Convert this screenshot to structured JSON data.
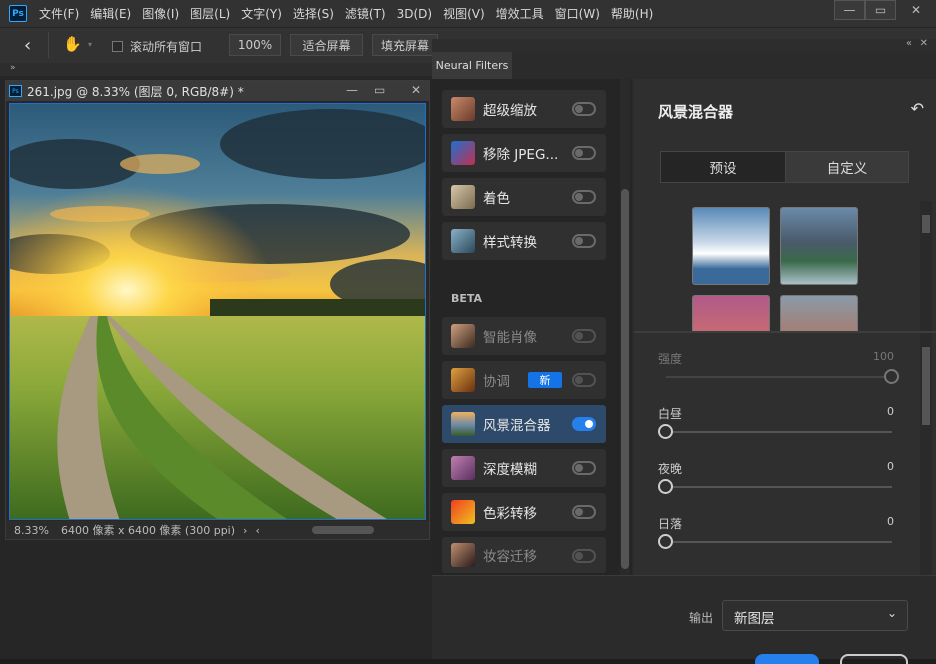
{
  "app": {
    "logo": "Ps"
  },
  "menu": [
    "文件(F)",
    "编辑(E)",
    "图像(I)",
    "图层(L)",
    "文字(Y)",
    "选择(S)",
    "滤镜(T)",
    "3D(D)",
    "视图(V)",
    "增效工具",
    "窗口(W)",
    "帮助(H)"
  ],
  "options": {
    "scroll_all_label": "滚动所有窗口",
    "zoom_button": "100%",
    "fit_screen": "适合屏幕",
    "fill_screen": "填充屏幕"
  },
  "document": {
    "title": "261.jpg @ 8.33% (图层 0, RGB/8#) *",
    "zoom": "8.33%",
    "size_info": "6400 像素 x 6400 像素 (300 ppi)"
  },
  "neural_filters": {
    "tab_label": "Neural Filters",
    "beta_label": "BETA",
    "new_badge": "新",
    "filters": [
      {
        "label": "超级缩放",
        "enabled": false,
        "dim": false
      },
      {
        "label": "移除 JPEG...",
        "enabled": false,
        "dim": false
      },
      {
        "label": "着色",
        "enabled": false,
        "dim": false
      },
      {
        "label": "样式转换",
        "enabled": false,
        "dim": false
      },
      {
        "label": "智能肖像",
        "enabled": false,
        "dim": true
      },
      {
        "label": "协调",
        "enabled": false,
        "dim": true
      },
      {
        "label": "风景混合器",
        "enabled": true,
        "dim": false
      },
      {
        "label": "深度模糊",
        "enabled": false,
        "dim": false
      },
      {
        "label": "色彩转移",
        "enabled": false,
        "dim": false
      },
      {
        "label": "妆容迁移",
        "enabled": false,
        "dim": true
      }
    ],
    "panel_title": "风景混合器",
    "seg_preset": "预设",
    "seg_custom": "自定义",
    "sliders": [
      {
        "label": "强度",
        "value": "100",
        "fraction": 1.0,
        "dim": true
      },
      {
        "label": "白昼",
        "value": "0",
        "fraction": 0.0,
        "dim": false
      },
      {
        "label": "夜晚",
        "value": "0",
        "fraction": 0.0,
        "dim": false
      },
      {
        "label": "日落",
        "value": "0",
        "fraction": 0.0,
        "dim": false
      }
    ],
    "output_label": "输出",
    "output_value": "新图层"
  },
  "colors": {
    "accent": "#2680eb",
    "selected_row": "#2e4a6a"
  }
}
